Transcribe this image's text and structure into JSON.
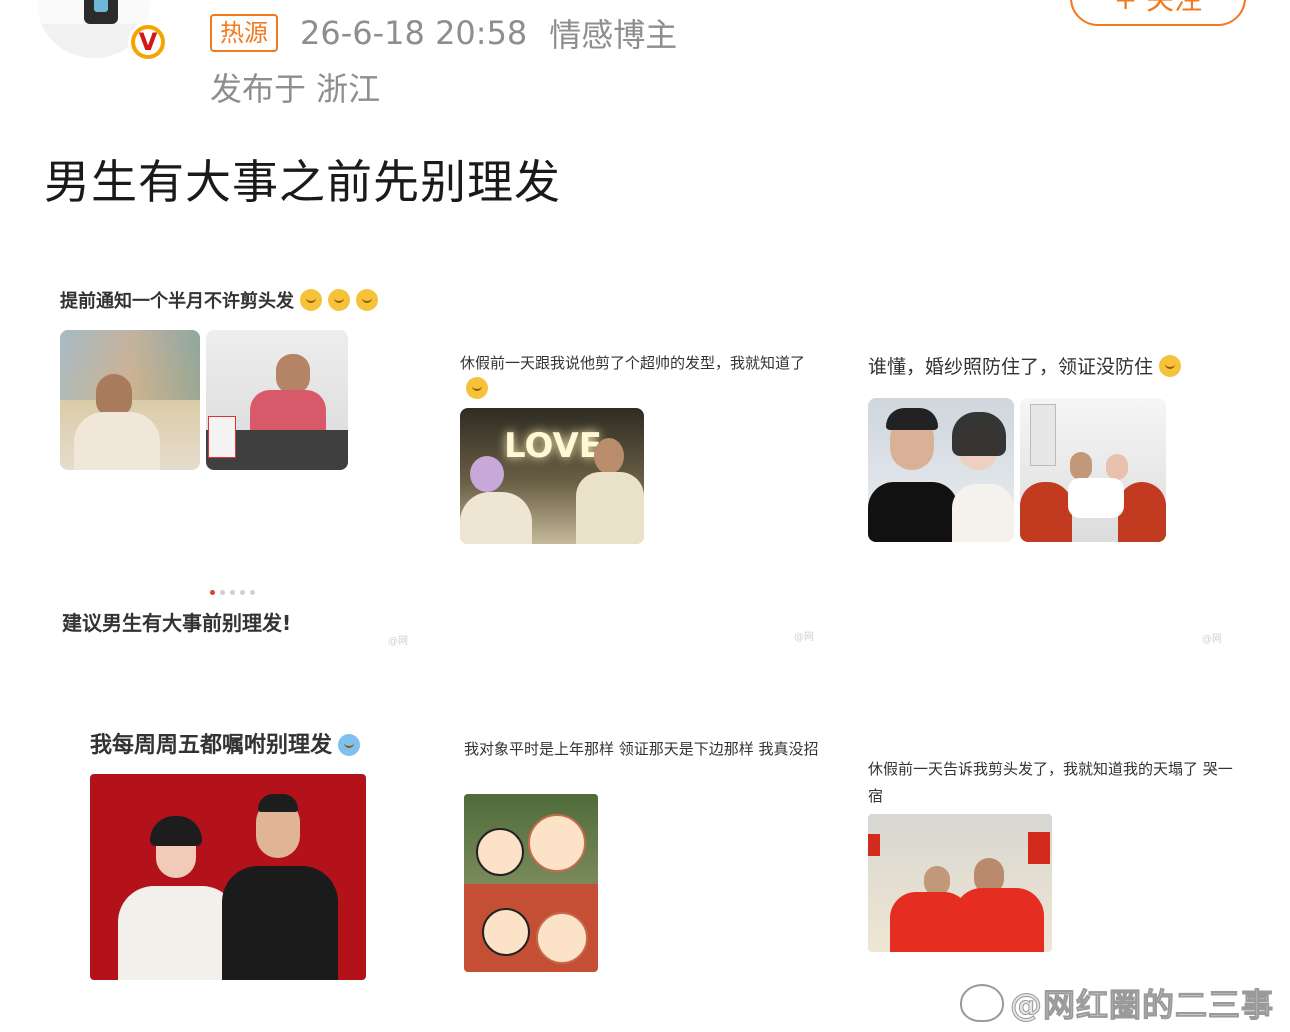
{
  "header": {
    "hot_tag": "热源",
    "date": "26-6-18 20:58",
    "user_tag": "情感博主",
    "location": "发布于 浙江",
    "follow_label": "+ 关注"
  },
  "post": {
    "title": "男生有大事之前先别理发"
  },
  "grid": {
    "c1": "提前通知一个半月不许剪头发",
    "c1_footer": "建议男生有大事前别理发!",
    "c2": "休假前一天跟我说他剪了个超帅的发型，我就知道了",
    "c3": "谁懂，婚纱照防住了，领证没防住",
    "c4": "我每周周五都嘱咐别理发",
    "c5": "我对象平时是上年那样 领证那天是下边那样 我真没招",
    "c6": "休假前一天告诉我剪头发了，我就知道我的天塌了 哭一宿",
    "love_text": "LOVE"
  },
  "watermark": {
    "text": "@网红圈的二三事",
    "small": "@网"
  },
  "colors": {
    "accent": "#f2791e",
    "meta_gray": "#8e8e8e",
    "red_bg": "#b3121b"
  }
}
